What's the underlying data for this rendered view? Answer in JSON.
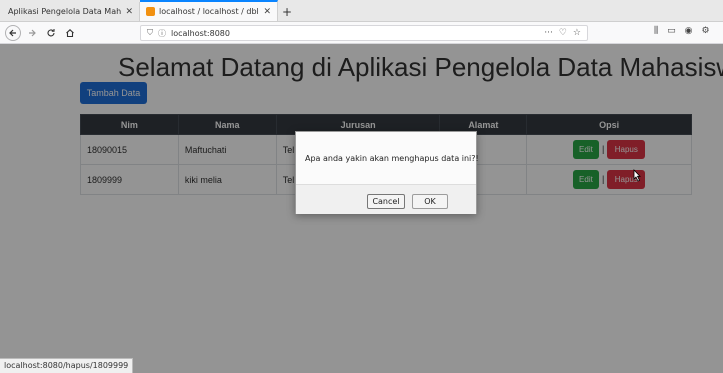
{
  "browser": {
    "tabs": [
      {
        "label": "Aplikasi Pengelola Data Mahas",
        "close": "✕",
        "active": true
      },
      {
        "label": "localhost / localhost / dbl",
        "close": "✕",
        "active": false
      }
    ],
    "new_tab": "+",
    "url": "localhost:8080",
    "url_menu": "···",
    "status_url": "localhost:8080/hapus/1809999"
  },
  "page": {
    "heading": "Selamat Datang di Aplikasi Pengelola Data Mahasiswa",
    "add_button": "Tambah Data",
    "table": {
      "headers": [
        "Nim",
        "Nama",
        "Jurusan",
        "Alamat",
        "Opsi"
      ],
      "rows": [
        {
          "nim": "18090015",
          "nama": "Maftuchati",
          "jurusan": "Tel",
          "alamat": "",
          "edit": "Edit",
          "sep": "|",
          "hapus": "Hapus"
        },
        {
          "nim": "1809999",
          "nama": "kiki melia",
          "jurusan": "Tel",
          "alamat": "",
          "edit": "Edit",
          "sep": "|",
          "hapus": "Hapus"
        }
      ]
    }
  },
  "dialog": {
    "message": "Apa anda yakin akan menghapus data ini?!",
    "cancel": "Cancel",
    "ok": "OK"
  },
  "colors": {
    "primary": "#1e6fd9",
    "success": "#28a745",
    "danger": "#dc3545",
    "table_header": "#343a40"
  }
}
